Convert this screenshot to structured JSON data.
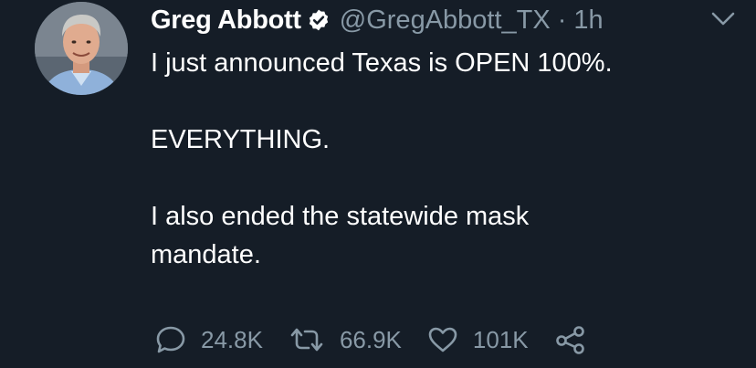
{
  "tweet": {
    "author_name": "Greg Abbott",
    "handle": "@GregAbbott_TX",
    "separator": "·",
    "time": "1h",
    "lines": [
      "I just announced Texas is OPEN 100%.",
      "EVERYTHING.",
      "I also ended the statewide mask",
      "mandate."
    ],
    "actions": {
      "replies": "24.8K",
      "retweets": "66.9K",
      "likes": "101K"
    }
  },
  "icons": [
    "verified-badge-icon",
    "chevron-down-icon",
    "reply-icon",
    "retweet-icon",
    "like-icon",
    "share-icon"
  ],
  "colors": {
    "background": "#151d27",
    "text": "#ffffff",
    "muted": "#8899a6"
  }
}
